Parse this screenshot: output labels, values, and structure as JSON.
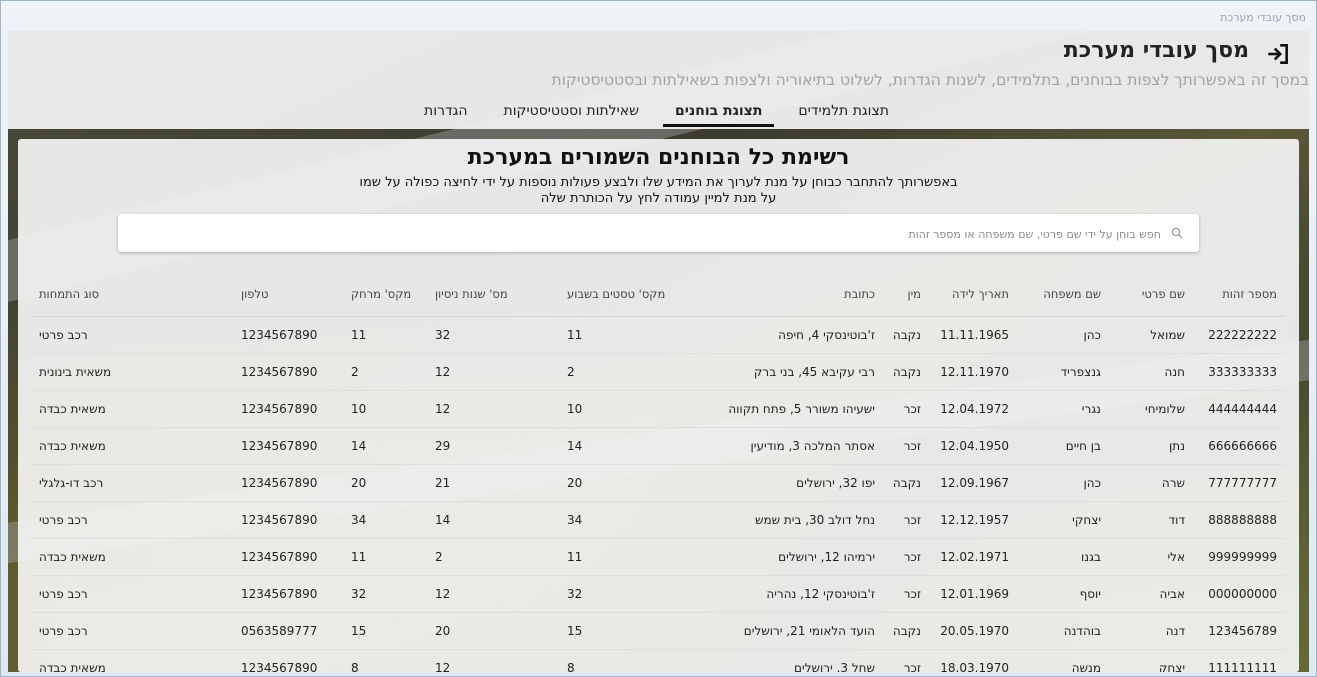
{
  "window": {
    "title": "מסך עובדי מערכת"
  },
  "header": {
    "title": "מסך עובדי מערכת",
    "subtitle": "במסך זה באפשרותך לצפות בבוחנים, בתלמידים, לשנות הגדרות, לשלוט בתיאוריה ולצפות בשאילתות ובסטטיסטיקות",
    "exit_icon": "logout-icon"
  },
  "tabs": [
    {
      "label": "תצוגת תלמידים",
      "active": false
    },
    {
      "label": "תצוגת בוחנים",
      "active": true
    },
    {
      "label": "שאילתות וסטטיסטיקות",
      "active": false
    },
    {
      "label": "הגדרות",
      "active": false
    }
  ],
  "panel": {
    "title": "רשימת כל הבוחנים השמורים במערכת",
    "desc_line1": "באפשרותך להתחבר כבוחן על מנת לערוך את המידע שלו ולבצע פעולות נוספות על ידי לחיצה כפולה על שמו",
    "desc_line2": "על מנת למיין עמודה לחץ על הכותרת שלה"
  },
  "search": {
    "placeholder": "חפש בוחן על ידי שם פרטי, שם משפחה או מספר זהות",
    "value": ""
  },
  "table": {
    "columns": [
      "מספר זהות",
      "שם פרטי",
      "שם משפחה",
      "תאריך לידה",
      "מין",
      "כתובת",
      "מקס' טסטים בשבוע",
      "מס' שנות ניסיון",
      "מקס' מרחק",
      "טלפון",
      "סוג התמחות"
    ],
    "rows": [
      [
        "222222222",
        "שמואל",
        "כהן",
        "11.11.1965",
        "נקבה",
        "ז'בוטינסקי 4, חיפה",
        "11",
        "32",
        "11",
        "1234567890",
        "רכב פרטי"
      ],
      [
        "333333333",
        "חנה",
        "גנצפריד",
        "12.11.1970",
        "נקבה",
        "רבי עקיבא 45, בני ברק",
        "2",
        "12",
        "2",
        "1234567890",
        "משאית בינונית"
      ],
      [
        "444444444",
        "שלומיחי",
        "נגרי",
        "12.04.1972",
        "זכר",
        "ישעיהו משורר 5, פתח תקווה",
        "10",
        "12",
        "10",
        "1234567890",
        "משאית כבדה"
      ],
      [
        "666666666",
        "נתן",
        "בן חיים",
        "12.04.1950",
        "זכר",
        "אסתר המלכה 3, מודיעין",
        "14",
        "29",
        "14",
        "1234567890",
        "משאית כבדה"
      ],
      [
        "777777777",
        "שרה",
        "כהן",
        "12.09.1967",
        "נקבה",
        "יפו 32, ירושלים",
        "20",
        "21",
        "20",
        "1234567890",
        "רכב דו-גלגלי"
      ],
      [
        "888888888",
        "דוד",
        "יצחקי",
        "12.12.1957",
        "זכר",
        "נחל דולב 30, בית שמש",
        "34",
        "14",
        "34",
        "1234567890",
        "רכב פרטי"
      ],
      [
        "999999999",
        "אלי",
        "בגנו",
        "12.02.1971",
        "זכר",
        "ירמיהו 12, ירושלים",
        "11",
        "2",
        "11",
        "1234567890",
        "משאית כבדה"
      ],
      [
        "000000000",
        "אביה",
        "יוסף",
        "12.01.1969",
        "זכר",
        "ז'בוטינסקי 12, נהריה",
        "32",
        "12",
        "32",
        "1234567890",
        "רכב פרטי"
      ],
      [
        "123456789",
        "דנה",
        "בוהדנה",
        "20.05.1970",
        "נקבה",
        "הועד הלאומי 21, ירושלים",
        "15",
        "20",
        "15",
        "0563589777",
        "רכב פרטי"
      ],
      [
        "111111111",
        "יצחק",
        "מנשה",
        "18.03.1970",
        "זכר",
        "שחל 3, ירושלים",
        "8",
        "12",
        "8",
        "1234567890",
        "משאית כבדה"
      ]
    ]
  }
}
